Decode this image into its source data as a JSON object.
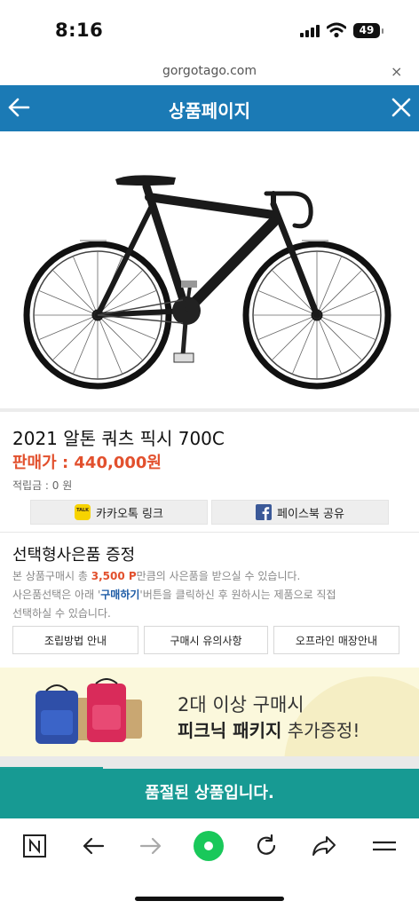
{
  "status_bar": {
    "time": "8:16",
    "battery": "49"
  },
  "browser": {
    "url": "gorgotago.com",
    "close_glyph": "×"
  },
  "header": {
    "title": "상품페이지"
  },
  "product": {
    "name": "2021 알톤 쿼츠 픽시 700C",
    "price": "판매가 : 440,000원",
    "points": "적립금 : 0 원"
  },
  "share": {
    "kakao_label": "카카오톡 링크",
    "kakao_icon_text": "TALK",
    "facebook_label": "페이스북 공유"
  },
  "gift": {
    "title": "선택형사은품 증정",
    "line1_prefix": "본 상품구매시 총 ",
    "line1_highlight": "3,500 P",
    "line1_suffix": "만큼의 사은품을 받으실 수 있습니다.",
    "line2_prefix": "사은품선택은 아래 '",
    "line2_highlight": "구매하기",
    "line2_suffix": "'버튼을 클릭하신 후 원하시는 제품으로 직접",
    "line3": "선택하실 수 있습니다.",
    "buttons": [
      "조립방법 안내",
      "구매시 유의사항",
      "오프라인 매장안내"
    ]
  },
  "banner": {
    "line1": "2대 이상 구매시",
    "line2_bold": "피크닉 패키지",
    "line2_rest": " 추가증정!"
  },
  "sold_out": "품절된 상품입니다.",
  "colors": {
    "header": "#1b7ab5",
    "price": "#e2502d",
    "sold_out": "#179a93",
    "highlight": "#e2502d",
    "highlight_blue": "#1b5aa5"
  }
}
